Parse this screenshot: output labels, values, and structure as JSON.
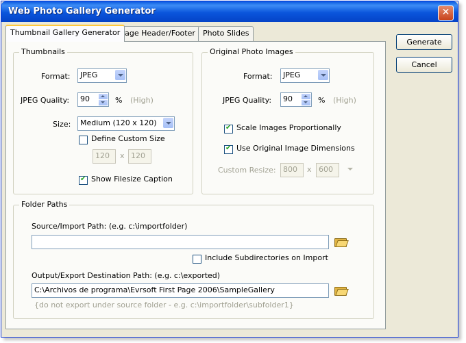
{
  "window": {
    "title": "Web Photo Gallery Generator"
  },
  "tabs": [
    "Thumbnail Gallery Generator",
    "Page Header/Footer",
    "Photo Slides"
  ],
  "thumbnails": {
    "legend": "Thumbnails",
    "format_label": "Format:",
    "format_value": "JPEG",
    "quality_label": "JPEG Quality:",
    "quality_value": "90",
    "quality_unit": "%",
    "quality_hint": "(High)",
    "size_label": "Size:",
    "size_value": "Medium (120 x 120)",
    "custom_size_label": "Define Custom Size",
    "custom_width": "120",
    "custom_x": "x",
    "custom_height": "120",
    "show_filesize_label": "Show Filesize Caption"
  },
  "original": {
    "legend": "Original Photo Images",
    "format_label": "Format:",
    "format_value": "JPEG",
    "quality_label": "JPEG Quality:",
    "quality_value": "90",
    "quality_unit": "%",
    "quality_hint": "(High)",
    "scale_label": "Scale Images Proportionally",
    "use_original_label": "Use Original Image Dimensions",
    "custom_resize_label": "Custom Resize:",
    "resize_width": "800",
    "resize_x": "x",
    "resize_height": "600"
  },
  "folders": {
    "legend": "Folder Paths",
    "source_label": "Source/Import Path: (e.g. c:\\importfolder)",
    "source_value": "",
    "include_sub_label": "Include Subdirectories on Import",
    "output_label": "Output/Export Destination Path: (e.g. c:\\exported)",
    "output_value": "C:\\Archivos de programa\\Evrsoft First Page 2006\\SampleGallery",
    "output_hint": "{do not export under source folder - e.g. c:\\importfolder\\subfolder1}"
  },
  "buttons": {
    "generate": "Generate",
    "cancel": "Cancel"
  },
  "states": {
    "custom_size": false,
    "show_filesize": true,
    "scale_proportional": true,
    "use_original": true,
    "include_subdirs": false
  }
}
